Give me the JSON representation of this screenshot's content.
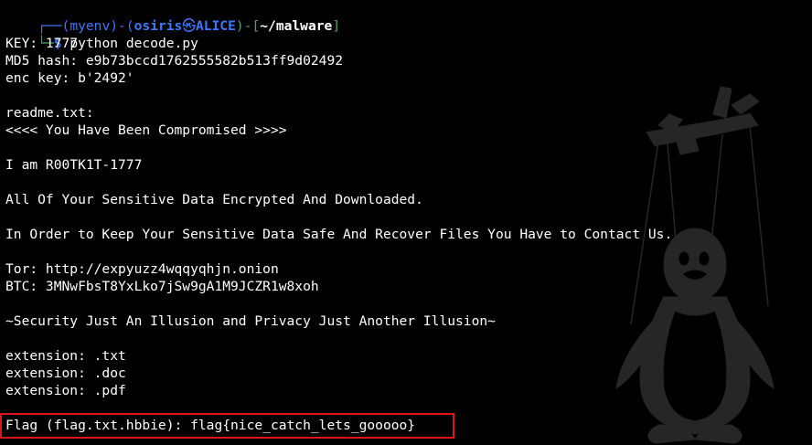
{
  "prompt": {
    "corner_top": "┌──",
    "corner_bottom": "└─",
    "open_paren": "(",
    "env": "myenv",
    "close_paren": ")-",
    "open_paren2": "(",
    "user": "osiris",
    "host_icon": "㉿",
    "host": "ALICE",
    "close_paren2": ")-[",
    "path": "~/malware",
    "close_bracket": "]",
    "dollar": "$",
    "command": "python decode.py"
  },
  "output_lines": [
    "KEY: 1777",
    "MD5 hash: e9b73bccd1762555582b513ff9d02492",
    "enc key: b'2492'",
    "",
    "readme.txt:",
    "<<<< You Have Been Compromised >>>>",
    "",
    "I am R00TK1T-1777",
    "",
    "All Of Your Sensitive Data Encrypted And Downloaded.",
    "",
    "In Order to Keep Your Sensitive Data Safe And Recover Files You Have to Contact Us.",
    "",
    "Tor: http://expyuzz4wqqyqhjn.onion",
    "BTC: 3MNwFbsT8YxLko7jSw9gA1M9JCZR1w8xoh",
    "",
    "~Security Just An Illusion and Privacy Just Another Illusion~",
    "",
    "extension: .txt",
    "extension: .doc",
    "extension: .pdf",
    ""
  ],
  "flag_line": "Flag (flag.txt.hbbie): flag{nice_catch_lets_gooooo}",
  "colors": {
    "background": "#000000",
    "text": "#ffffff",
    "prompt_blue": "#3b78ff",
    "prompt_green": "#47a86b",
    "highlight_border": "#e0151b",
    "watermark": "#2a2a2a"
  },
  "icons": {
    "watermark": "linux-penguin-puppet-icon"
  }
}
